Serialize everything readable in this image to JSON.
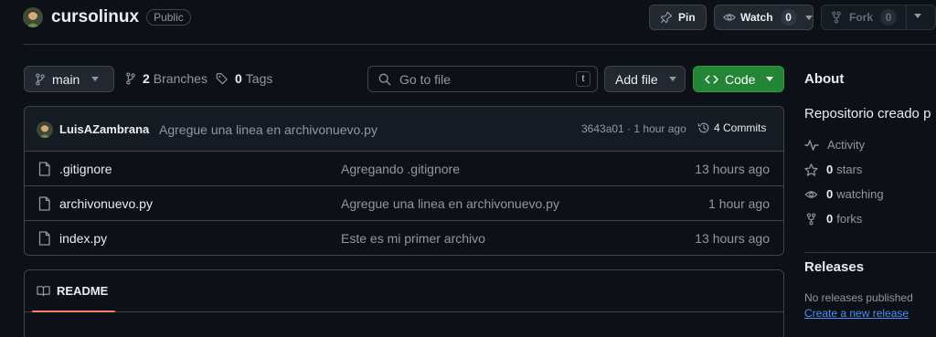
{
  "repo": {
    "name": "cursolinux",
    "visibility": "Public"
  },
  "actions": {
    "pin_label": "Pin",
    "watch_label": "Watch",
    "watch_count": "0",
    "fork_label": "Fork",
    "fork_count": "0"
  },
  "toolbar": {
    "branch": "main",
    "branches_count": "2",
    "branches_label": "Branches",
    "tags_count": "0",
    "tags_label": "Tags",
    "search_placeholder": "Go to file",
    "search_shortcut": "t",
    "add_file_label": "Add file",
    "code_label": "Code"
  },
  "commit": {
    "author": "LuisAZambrana",
    "message": "Agregue una linea en archivonuevo.py",
    "sha_time": "3643a01 · 1 hour ago",
    "commits_label": "4 Commits"
  },
  "files": [
    {
      "name": ".gitignore",
      "message": "Agregando .gitignore",
      "age": "13 hours ago"
    },
    {
      "name": "archivonuevo.py",
      "message": "Agregue una linea en archivonuevo.py",
      "age": "1 hour ago"
    },
    {
      "name": "index.py",
      "message": "Este es mi primer archivo",
      "age": "13 hours ago"
    }
  ],
  "readme": {
    "tab_label": "README"
  },
  "sidebar": {
    "about_heading": "About",
    "description": "Repositorio creado p",
    "activity_label": "Activity",
    "stars_count": "0",
    "stars_label": "stars",
    "watching_count": "0",
    "watching_label": "watching",
    "forks_count": "0",
    "forks_label": "forks",
    "releases_heading": "Releases",
    "no_releases": "No releases published",
    "create_release": "Create a new release"
  },
  "colors": {
    "background": "#0d1117",
    "border": "#3d444d",
    "code_button": "#238636",
    "link": "#4493f8",
    "readme_accent": "#f78166"
  }
}
